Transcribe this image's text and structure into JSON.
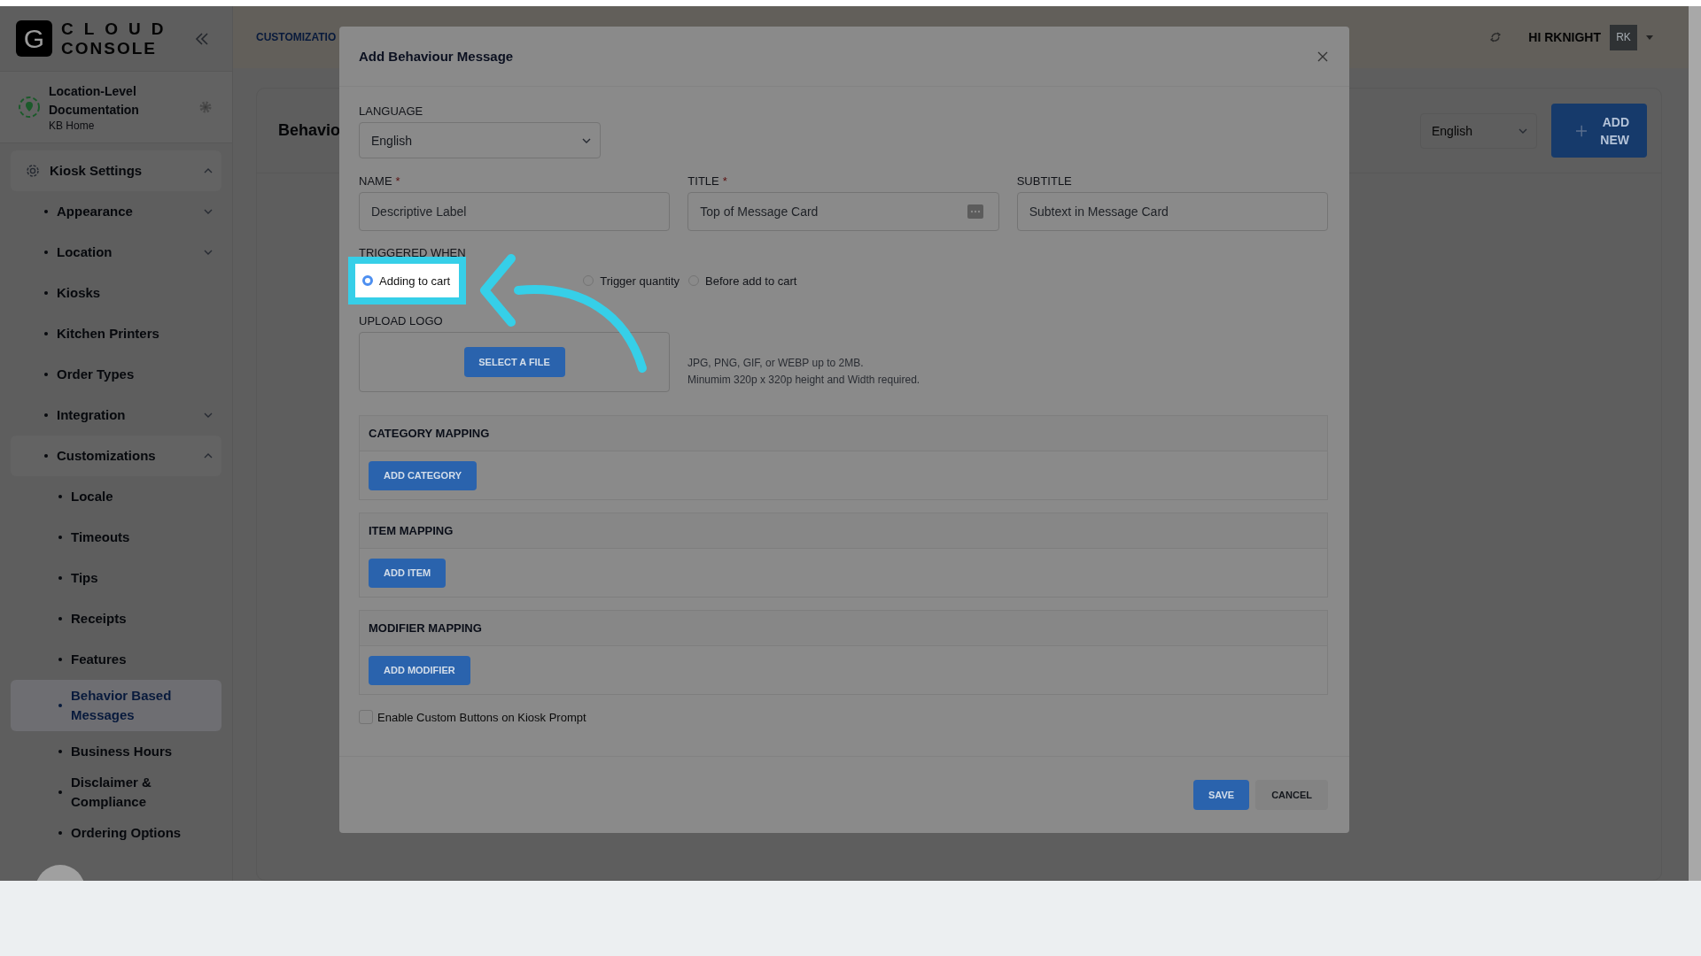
{
  "app": {
    "logo_letter": "G",
    "logo_lines": [
      "CLOUD",
      "CONSOLE"
    ]
  },
  "location": {
    "name": "Location-Level Documentation",
    "subtitle": "KB Home"
  },
  "sidebar": {
    "items": [
      {
        "label": "Kiosk Settings",
        "expanded": true,
        "selected": false,
        "children": [
          {
            "label": "Appearance",
            "expanded": false,
            "selected": false
          },
          {
            "label": "Location",
            "expanded": false,
            "selected": false
          },
          {
            "label": "Kiosks",
            "selected": false
          },
          {
            "label": "Kitchen Printers",
            "selected": false
          },
          {
            "label": "Order Types",
            "selected": false
          },
          {
            "label": "Integration",
            "expanded": false,
            "selected": false
          },
          {
            "label": "Customizations",
            "expanded": true,
            "selected": false,
            "children": [
              {
                "label": "Locale",
                "selected": false
              },
              {
                "label": "Timeouts",
                "selected": false
              },
              {
                "label": "Tips",
                "selected": false
              },
              {
                "label": "Receipts",
                "selected": false
              },
              {
                "label": "Features",
                "selected": false
              },
              {
                "label": "Behavior Based Messages",
                "selected": true
              },
              {
                "label": "Business Hours",
                "selected": false
              },
              {
                "label": "Disclaimer & Compliance",
                "selected": false
              },
              {
                "label": "Ordering Options",
                "selected": false
              }
            ]
          }
        ]
      }
    ]
  },
  "header": {
    "breadcrumb": "CUSTOMIZATIO",
    "greeting": "HI RKNIGHT",
    "avatar": "RK"
  },
  "page": {
    "title": "Behavio",
    "language": "English",
    "add_button": "ADD NEW"
  },
  "modal": {
    "title": "Add Behaviour Message",
    "language": {
      "label": "LANGUAGE",
      "value": "English"
    },
    "fields": [
      {
        "label": "NAME",
        "required_mark": "*",
        "placeholder": "Descriptive Label",
        "kind": "text"
      },
      {
        "label": "TITLE",
        "required_mark": "*",
        "placeholder": "Top of Message Card",
        "kind": "emoji"
      },
      {
        "label": "SUBTITLE",
        "placeholder": "Subtext in Message Card",
        "kind": "text"
      }
    ],
    "trigger": {
      "label": "TRIGGERED WHEN",
      "options": [
        {
          "label": "Adding to cart",
          "selected": true,
          "highlighted": true
        },
        {
          "label": "Trigger quantity",
          "selected": false,
          "highlighted": false
        },
        {
          "label": "Before add to cart",
          "selected": false,
          "highlighted": false
        }
      ]
    },
    "upload": {
      "label": "UPLOAD LOGO",
      "button": "SELECT A FILE",
      "hints": [
        "JPG, PNG, GIF, or WEBP up to 2MB.",
        "Minumim 320p x 320p height and Width required."
      ]
    },
    "sections": [
      {
        "title": "CATEGORY MAPPING",
        "button": "ADD CATEGORY"
      },
      {
        "title": "ITEM MAPPING",
        "button": "ADD ITEM"
      },
      {
        "title": "MODIFIER MAPPING",
        "button": "ADD MODIFIER"
      }
    ],
    "checkbox": {
      "label": "Enable Custom Buttons on Kiosk Prompt",
      "checked": false
    },
    "buttons": [
      {
        "label": "SAVE",
        "kind": "primary"
      },
      {
        "label": "CANCEL",
        "kind": "secondary"
      }
    ]
  }
}
